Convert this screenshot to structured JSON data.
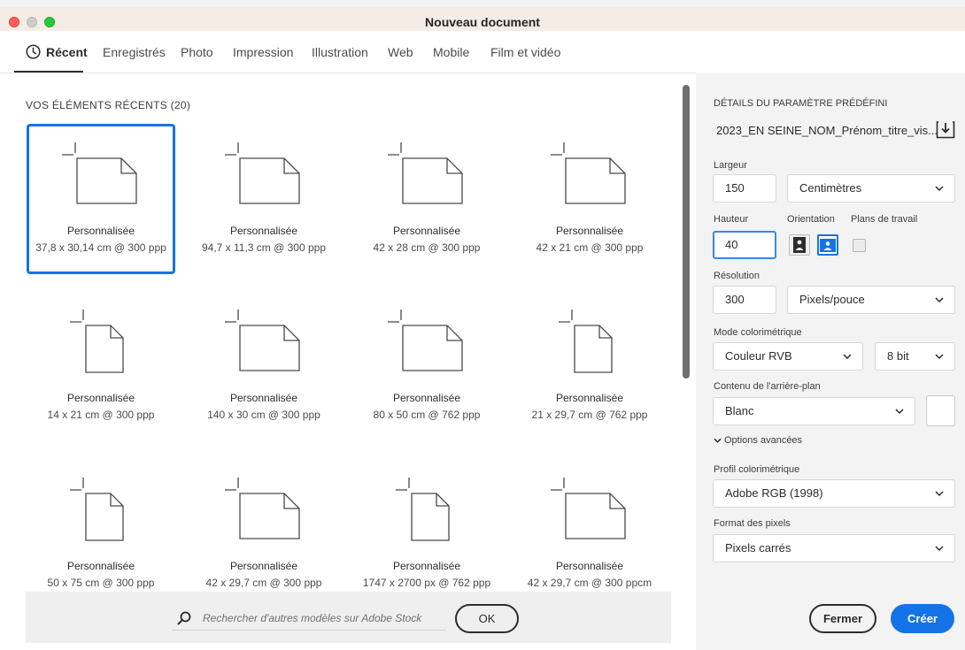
{
  "window": {
    "title": "Nouveau document"
  },
  "tabs": [
    {
      "label": "Récent",
      "active": true
    },
    {
      "label": "Enregistrés"
    },
    {
      "label": "Photo"
    },
    {
      "label": "Impression"
    },
    {
      "label": "Illustration"
    },
    {
      "label": "Web"
    },
    {
      "label": "Mobile"
    },
    {
      "label": "Film et vidéo"
    }
  ],
  "recent": {
    "title": "VOS ÉLÉMENTS RÉCENTS (20)",
    "items": [
      {
        "name": "Personnalisée",
        "size": "37,8 x 30,14 cm @ 300 ppp",
        "orientation": "landscape",
        "selected": true
      },
      {
        "name": "Personnalisée",
        "size": "94,7 x 11,3 cm @ 300 ppp",
        "orientation": "landscape"
      },
      {
        "name": "Personnalisée",
        "size": "42 x 28 cm @ 300 ppp",
        "orientation": "landscape"
      },
      {
        "name": "Personnalisée",
        "size": "42 x 21 cm @ 300 ppp",
        "orientation": "landscape"
      },
      {
        "name": "Personnalisée",
        "size": "14 x 21 cm @ 300 ppp",
        "orientation": "portrait"
      },
      {
        "name": "Personnalisée",
        "size": "140 x 30 cm @ 300 ppp",
        "orientation": "landscape"
      },
      {
        "name": "Personnalisée",
        "size": "80 x 50 cm @ 762 ppp",
        "orientation": "landscape"
      },
      {
        "name": "Personnalisée",
        "size": "21 x 29,7 cm @ 762 ppp",
        "orientation": "portrait"
      },
      {
        "name": "Personnalisée",
        "size": "50 x 75 cm @ 300 ppp",
        "orientation": "portrait"
      },
      {
        "name": "Personnalisée",
        "size": "42 x 29,7 cm @ 300 ppp",
        "orientation": "landscape"
      },
      {
        "name": "Personnalisée",
        "size": "1747 x 2700 px @ 762 ppp",
        "orientation": "portrait"
      },
      {
        "name": "Personnalisée",
        "size": "42 x 29,7 cm @ 300 ppcm",
        "orientation": "landscape"
      }
    ]
  },
  "search": {
    "placeholder": "Rechercher d'autres modèles sur Adobe Stock",
    "ok_label": "OK"
  },
  "details": {
    "section_title": "DÉTAILS DU PARAMÈTRE PRÉDÉFINI",
    "preset_name": "2023_EN SEINE_NOM_Prénom_titre_vis...",
    "width_label": "Largeur",
    "width_value": "150",
    "width_unit": "Centimètres",
    "height_label": "Hauteur",
    "height_value": "40",
    "orientation_label": "Orientation",
    "artboards_label": "Plans de travail",
    "resolution_label": "Résolution",
    "resolution_value": "300",
    "resolution_unit": "Pixels/pouce",
    "color_mode_label": "Mode colorimétrique",
    "color_mode_value": "Couleur RVB",
    "bit_depth_value": "8 bit",
    "background_label": "Contenu de l'arrière-plan",
    "background_value": "Blanc",
    "advanced_label": "Options avancées",
    "profile_label": "Profil colorimétrique",
    "profile_value": "Adobe RGB (1998)",
    "pixel_format_label": "Format des pixels",
    "pixel_format_value": "Pixels carrés"
  },
  "actions": {
    "close_label": "Fermer",
    "create_label": "Créer"
  },
  "colors": {
    "accent": "#1473e6",
    "titlebar": "#f5ece6",
    "panel": "#f3f3f3"
  }
}
